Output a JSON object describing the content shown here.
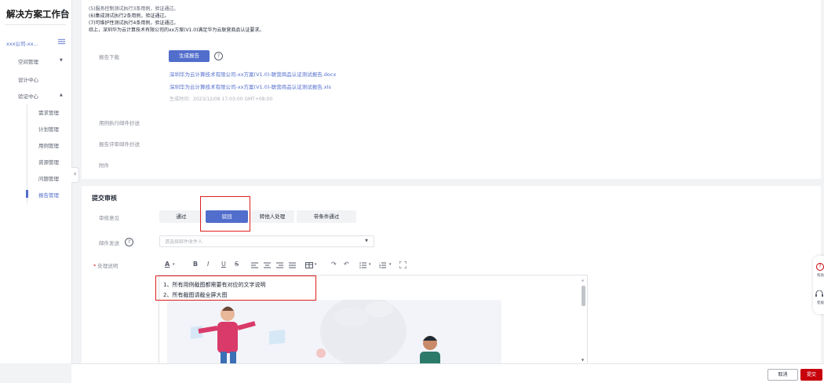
{
  "sidebar": {
    "title": "解决方案工作台",
    "company": "xxx公司-xx...",
    "items": [
      {
        "label": "空间管理",
        "arrow": "▼"
      },
      {
        "label": "设计中心"
      },
      {
        "label": "验证中心",
        "arrow": "▲"
      }
    ],
    "sub_items": [
      "需求管理",
      "计划管理",
      "用例管理",
      "资源管理",
      "问题管理",
      "报告管理"
    ],
    "active_sub": "报告管理"
  },
  "report": {
    "requirement_lines": [
      "(5)服务控制测试执行3条用例，验证通过。",
      "(6)集成测试执行2条用例，验证通过。",
      "(7)可维护性测试执行4条用例，验证通过。",
      "综上，深圳华为云计算技术有限公司的xx方案(V1.0)满足华为云联营商品认证要求。"
    ],
    "download_label": "报告下载",
    "generate_button": "生成报告",
    "files": [
      "深圳华为云计算技术有限公司-xx方案(V1.0)-联营商品认证测试报告.docx",
      "深圳华为云计算技术有限公司-xx方案(V1.0)-联营商品认证测试报告.xls"
    ],
    "generated_time": "生成时间：2023/12/08 17:03:00 GMT+08:00",
    "case_email_label": "用例执行邮件抄送",
    "review_email_label": "报告评审邮件抄送",
    "attachment_label": "附件"
  },
  "review": {
    "section_title": "提交审核",
    "opinion_label": "审核意见",
    "options": [
      "通过",
      "驳回",
      "转他人处理",
      "带条件通过"
    ],
    "selected_option": "驳回",
    "email_label": "邮件发送",
    "email_placeholder": "请选择邮件收件人",
    "explain_label": "处理说明",
    "required_mark": "*",
    "editor_lines": [
      "1、所有用例截图都需要有对应的文字说明",
      "2、所有截图请截全屏大图"
    ]
  },
  "toolbar": {
    "font_color": "A",
    "bold": "B",
    "italic": "I",
    "underline": "U",
    "strike": "S"
  },
  "footer": {
    "cancel": "取消",
    "submit": "提交"
  },
  "float_panel": {
    "help": "帮助",
    "service": "客服"
  },
  "colors": {
    "primary": "#526ecc",
    "danger": "#c7000b",
    "annotation": "#e02020"
  }
}
